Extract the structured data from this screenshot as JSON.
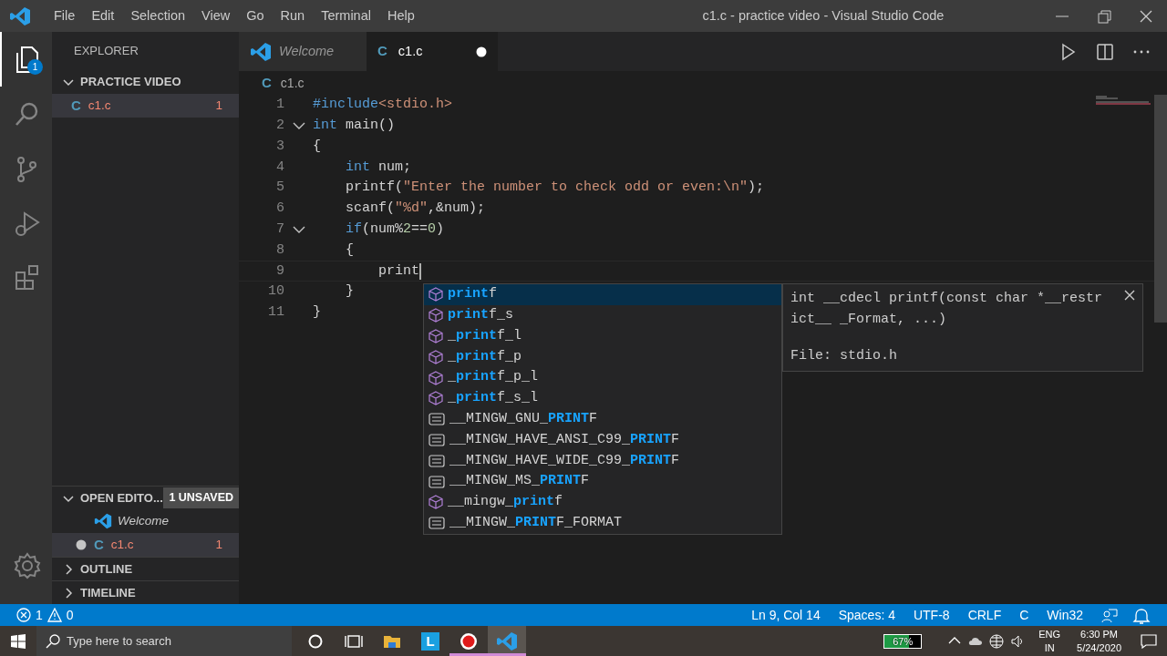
{
  "title_bar": {
    "menus": [
      "File",
      "Edit",
      "Selection",
      "View",
      "Go",
      "Run",
      "Terminal",
      "Help"
    ],
    "title": "c1.c - practice video - Visual Studio Code"
  },
  "activity_bar": [
    {
      "kind": "explorer",
      "selected": true,
      "badge": "1"
    },
    {
      "kind": "search",
      "selected": false
    },
    {
      "kind": "source-control",
      "selected": false
    },
    {
      "kind": "run",
      "selected": false
    },
    {
      "kind": "extensions",
      "selected": false
    }
  ],
  "sidebar": {
    "title": "EXPLORER",
    "folder": {
      "name": "PRACTICE VIDEO",
      "expanded": true,
      "files": [
        {
          "name": "c1.c",
          "icon": "C",
          "problems": "1",
          "selected": true
        }
      ]
    },
    "open_editors": {
      "title": "OPEN EDITO...",
      "badge": "1 UNSAVED",
      "expanded": true,
      "items": [
        {
          "name": "Welcome",
          "kind": "welcome",
          "dirty": false,
          "selected": false
        },
        {
          "name": "c1.c",
          "kind": "c",
          "icon": "C",
          "dirty": true,
          "problems": "1",
          "selected": true
        }
      ]
    },
    "sections": [
      {
        "title": "OUTLINE",
        "expanded": false
      },
      {
        "title": "TIMELINE",
        "expanded": false
      }
    ]
  },
  "tabs": [
    {
      "label": "Welcome",
      "kind": "welcome",
      "selected": false,
      "dirty": false
    },
    {
      "label": "c1.c",
      "kind": "c",
      "icon": "C",
      "selected": true,
      "dirty": true
    }
  ],
  "breadcrumb": {
    "icon": "C",
    "file": "c1.c"
  },
  "editor": {
    "lines": [
      {
        "number": "1",
        "foldable": false,
        "current": false,
        "tokens": [
          {
            "kind": "keyword",
            "text": "#include"
          },
          {
            "kind": "string",
            "text": "<stdio.h>"
          }
        ]
      },
      {
        "number": "2",
        "foldable": true,
        "current": false,
        "tokens": [
          {
            "kind": "keyword",
            "text": "int"
          },
          {
            "kind": "plain",
            "text": " main()"
          }
        ]
      },
      {
        "number": "3",
        "foldable": false,
        "current": false,
        "tokens": [
          {
            "kind": "plain",
            "text": "{"
          }
        ]
      },
      {
        "number": "4",
        "foldable": false,
        "current": false,
        "tokens": [
          {
            "kind": "keyword",
            "text": "    int"
          },
          {
            "kind": "plain",
            "text": " num;"
          }
        ]
      },
      {
        "number": "5",
        "foldable": false,
        "current": false,
        "tokens": [
          {
            "kind": "plain",
            "text": "    printf("
          },
          {
            "kind": "string",
            "text": "\"Enter the number to check odd or even:\\n\""
          },
          {
            "kind": "plain",
            "text": ");"
          }
        ]
      },
      {
        "number": "6",
        "foldable": false,
        "current": false,
        "tokens": [
          {
            "kind": "plain",
            "text": "    scanf("
          },
          {
            "kind": "string",
            "text": "\"%d\""
          },
          {
            "kind": "plain",
            "text": ",&num);"
          }
        ]
      },
      {
        "number": "7",
        "foldable": true,
        "current": false,
        "tokens": [
          {
            "kind": "keyword",
            "text": "    if"
          },
          {
            "kind": "plain",
            "text": "(num%"
          },
          {
            "kind": "number",
            "text": "2"
          },
          {
            "kind": "plain",
            "text": "=="
          },
          {
            "kind": "number",
            "text": "0"
          },
          {
            "kind": "plain",
            "text": ")"
          }
        ]
      },
      {
        "number": "8",
        "foldable": false,
        "current": false,
        "tokens": [
          {
            "kind": "plain",
            "text": "    {"
          }
        ]
      },
      {
        "number": "9",
        "foldable": false,
        "current": true,
        "tokens": [
          {
            "kind": "plain",
            "text": "        print"
          }
        ]
      },
      {
        "number": "10",
        "foldable": false,
        "current": false,
        "tokens": [
          {
            "kind": "plain",
            "text": "    }"
          }
        ]
      },
      {
        "number": "11",
        "foldable": false,
        "current": false,
        "tokens": [
          {
            "kind": "plain",
            "text": "}"
          }
        ]
      }
    ]
  },
  "suggestions": {
    "items": [
      {
        "kind": "function",
        "match": "print",
        "after": "f",
        "selected": true
      },
      {
        "kind": "function",
        "match": "print",
        "after": "f_s",
        "selected": false
      },
      {
        "kind": "function",
        "before": "_",
        "match": "print",
        "after": "f_l",
        "selected": false
      },
      {
        "kind": "function",
        "before": "_",
        "match": "print",
        "after": "f_p",
        "selected": false
      },
      {
        "kind": "function",
        "before": "_",
        "match": "print",
        "after": "f_p_l",
        "selected": false
      },
      {
        "kind": "function",
        "before": "_",
        "match": "print",
        "after": "f_s_l",
        "selected": false
      },
      {
        "kind": "macro",
        "before": "__MINGW_GNU_",
        "match": "PRINT",
        "after": "F",
        "selected": false
      },
      {
        "kind": "macro",
        "before": "__MINGW_HAVE_ANSI_C99_",
        "match": "PRINT",
        "after": "F",
        "selected": false
      },
      {
        "kind": "macro",
        "before": "__MINGW_HAVE_WIDE_C99_",
        "match": "PRINT",
        "after": "F",
        "selected": false
      },
      {
        "kind": "macro",
        "before": "__MINGW_MS_",
        "match": "PRINT",
        "after": "F",
        "selected": false
      },
      {
        "kind": "function",
        "before": "__mingw_",
        "match": "print",
        "after": "f",
        "selected": false
      },
      {
        "kind": "macro",
        "before": "__MINGW_",
        "match": "PRINT",
        "after": "F_FORMAT",
        "selected": false
      }
    ],
    "detail": {
      "signature": "int __cdecl printf(const char *__restrict__ _Format, ...)",
      "file": "File: stdio.h"
    }
  },
  "status_bar": {
    "errors": "1",
    "warnings": "0",
    "items": [
      "Ln 9, Col 14",
      "Spaces: 4",
      "UTF-8",
      "CRLF",
      "C",
      "Win32"
    ]
  },
  "taskbar": {
    "search_placeholder": "Type here to search",
    "apps": [
      {
        "kind": "cortana",
        "running": false,
        "active": false
      },
      {
        "kind": "task-view",
        "running": false,
        "active": false
      },
      {
        "kind": "files",
        "running": false,
        "active": false
      },
      {
        "kind": "letter-tile",
        "label": "L",
        "running": false,
        "active": false
      },
      {
        "kind": "recorder",
        "running": true,
        "active": false
      },
      {
        "kind": "vscode",
        "running": true,
        "active": true
      }
    ],
    "battery": {
      "level": 0.67,
      "text": "67%"
    },
    "language": [
      "ENG",
      "IN"
    ],
    "time": "6:30 PM",
    "date": "5/24/2020"
  }
}
